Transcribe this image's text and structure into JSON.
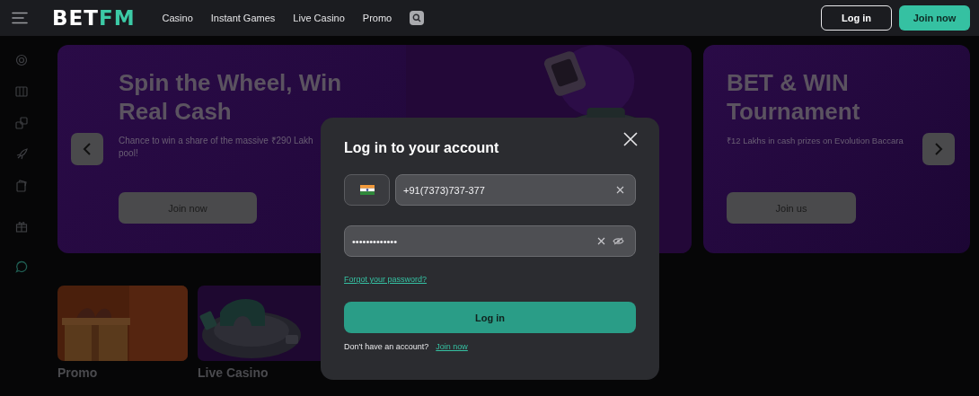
{
  "header": {
    "logo": {
      "primary": "BET",
      "accent": "FM"
    },
    "nav": [
      {
        "label": "Casino"
      },
      {
        "label": "Instant Games"
      },
      {
        "label": "Live Casino"
      },
      {
        "label": "Promo"
      }
    ],
    "buttons": [
      {
        "label": "Log in",
        "kind": "outline"
      },
      {
        "label": "Join now",
        "kind": "filled"
      }
    ]
  },
  "banners": [
    {
      "title": "Spin the Wheel, Win Real Cash",
      "description": [
        "Chance to win a share of the massive ₹290 Lakh",
        "pool!"
      ],
      "button": "Join now"
    },
    {
      "title": "BET & WIN Tournament",
      "description": [
        "₹12 Lakhs in cash prizes on Evolution Baccara"
      ],
      "button": "Join us"
    }
  ],
  "tiles": [
    {
      "label": "Promo"
    },
    {
      "label": "Live Casino"
    }
  ],
  "login_dialog": {
    "title": "Log in to your account",
    "phone": {
      "value": "+91(7373)737-377"
    },
    "password": {
      "value": "•••••••••••••"
    },
    "forgot_link": "Forgot your password?",
    "submit": "Log in",
    "signup_prompt": "Don't have an account?",
    "signup_link": "Join now"
  }
}
